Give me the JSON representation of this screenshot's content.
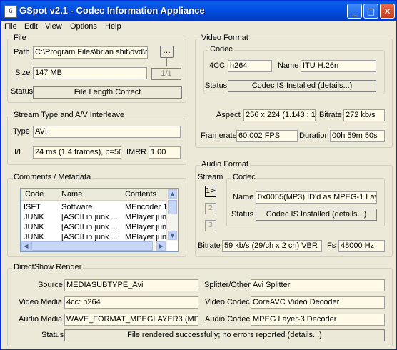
{
  "window": {
    "title": "GSpot v2.1 - Codec Information Appliance",
    "app_icon_glyph": "G",
    "buttons": {
      "minimize": "_",
      "maximize": "□",
      "close": "✕"
    }
  },
  "menu": [
    "File",
    "Edit",
    "View",
    "Options",
    "Help"
  ],
  "file": {
    "legend": "File",
    "path_label": "Path",
    "path_value": "C:\\Program Files\\brian shit\\dvd\\r",
    "browse_label": "...",
    "size_label": "Size",
    "size_value": "147 MB",
    "part_value": "1/1",
    "status_label": "Status",
    "status_value": "File Length Correct"
  },
  "stream": {
    "legend": "Stream Type and A/V Interleave",
    "type_label": "Type",
    "type_value": "AVI",
    "il_label": "I/L",
    "il_value": "24 ms (1.4 frames), p=504",
    "imrr_label": "IMRR",
    "imrr_value": "1.00"
  },
  "comments": {
    "legend": "Comments / Metadata",
    "columns": [
      "Code",
      "Name",
      "Contents"
    ],
    "rows": [
      [
        "ISFT",
        "Software",
        "MEncoder 1"
      ],
      [
        "JUNK",
        "[ASCII in junk ...",
        "MPlayer jun"
      ],
      [
        "JUNK",
        "[ASCII in junk ...",
        "MPlayer jun"
      ],
      [
        "JUNK",
        "[ASCII in junk ...",
        "MPlayer jun"
      ]
    ]
  },
  "video": {
    "legend": "Video Format",
    "codec_legend": "Codec",
    "fourcc_label": "4CC",
    "fourcc_value": "h264",
    "name_label": "Name",
    "name_value": "ITU H.26n",
    "status_label": "Status",
    "status_value": "Codec IS Installed  (details...)",
    "aspect_label": "Aspect",
    "aspect_value": "256 x 224  (1.143 : 1",
    "bitrate_label": "Bitrate",
    "bitrate_value": "272 kb/s",
    "framerate_label": "Framerate",
    "framerate_value": "60.002 FPS",
    "duration_label": "Duration",
    "duration_value": "00h 59m 50s"
  },
  "audio": {
    "legend": "Audio Format",
    "stream_label": "Stream",
    "stream_buttons": [
      "1>",
      "2",
      "3"
    ],
    "codec_legend": "Codec",
    "name_label": "Name",
    "name_value": "0x0055(MP3) ID'd as MPEG-1 Laye",
    "status_label": "Status",
    "status_value": "Codec IS Installed  (details...)",
    "bitrate_label": "Bitrate",
    "bitrate_value": "59 kb/s (29/ch x 2 ch) VBR",
    "fs_label": "Fs",
    "fs_value": "48000 Hz"
  },
  "directshow": {
    "legend": "DirectShow Render",
    "source_label": "Source",
    "source_value": "MEDIASUBTYPE_Avi",
    "splitter_label": "Splitter/Other",
    "splitter_value": "Avi Splitter",
    "video_media_label": "Video Media",
    "video_media_value": "4cc: h264",
    "video_codec_label": "Video Codec",
    "video_codec_value": "CoreAVC Video Decoder",
    "audio_media_label": "Audio Media",
    "audio_media_value": "WAVE_FORMAT_MPEGLAYER3 (MP",
    "audio_codec_label": "Audio Codec",
    "audio_codec_value": "MPEG Layer-3 Decoder",
    "status_label": "Status",
    "status_value": "File rendered successfully; no errors reported    (details...)"
  }
}
